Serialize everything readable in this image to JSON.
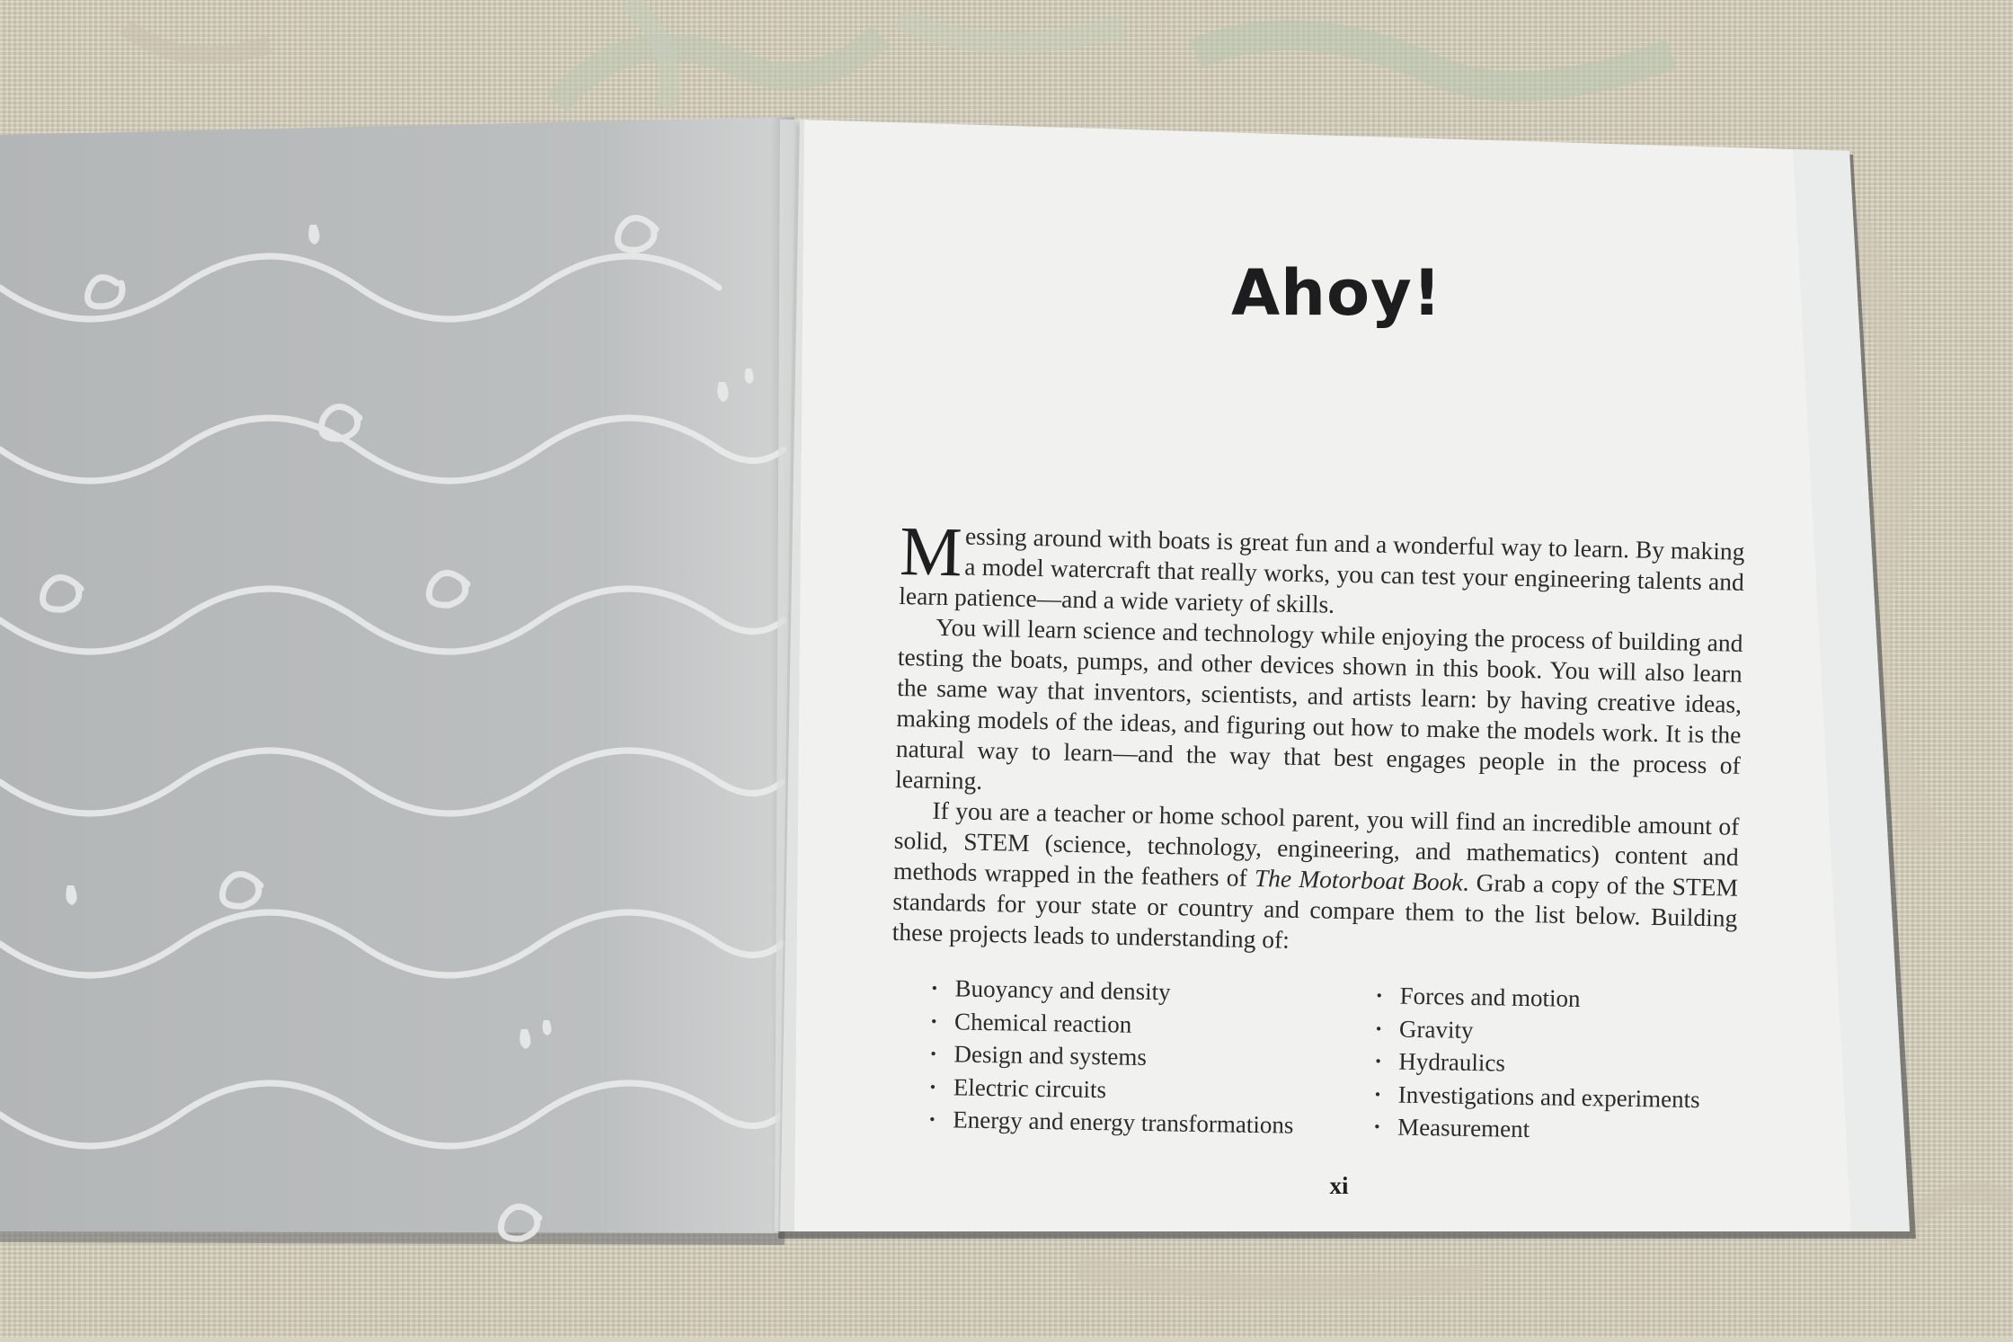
{
  "photo": {
    "subject": "open paperback book on carpet",
    "colors": {
      "carpet": "#d7d0bd",
      "left_page": "#b9bcbd",
      "left_page_pattern": "#eef0ef",
      "right_page": "#f2f3f0",
      "ink": "#2b2b2d"
    }
  },
  "left_page": {
    "pattern": "white wave lines with spiral swirls and water droplets"
  },
  "right_page": {
    "title": "Ahoy!",
    "drop_cap": "M",
    "paragraphs": {
      "p1": "essing around with boats is great fun and a wonderful way to learn. By making a model watercraft that really works, you can test your engineering talents and learn patience—and a wide variety of skills.",
      "p2": "You will learn science and technology while enjoying the process of building and testing the boats, pumps, and other devices shown in this book. You will also learn the same way that inventors, scientists, and artists learn: by having creative ideas, making models of the ideas, and figuring out how to make the models work. It is the natural way to learn—and the way that best engages people in the process of learning.",
      "p3_before_title": "If you are a teacher or home school parent, you will find an incredible amount of solid, STEM (science, technology, engineering, and mathematics) content and methods wrapped in the feathers of ",
      "p3_book_title": "The Motorboat Book",
      "p3_after_title": ". Grab a copy of the STEM standards for your state or country and compare them to the list below. Building these projects leads to understanding of:"
    },
    "bullet": "•",
    "topics_column_1": [
      "Buoyancy and density",
      "Chemical reaction",
      "Design and systems",
      "Electric circuits",
      "Energy and energy transformations"
    ],
    "topics_column_2": [
      "Forces and motion",
      "Gravity",
      "Hydraulics",
      "Investigations and experiments",
      "Measurement"
    ],
    "page_number": "xi"
  }
}
